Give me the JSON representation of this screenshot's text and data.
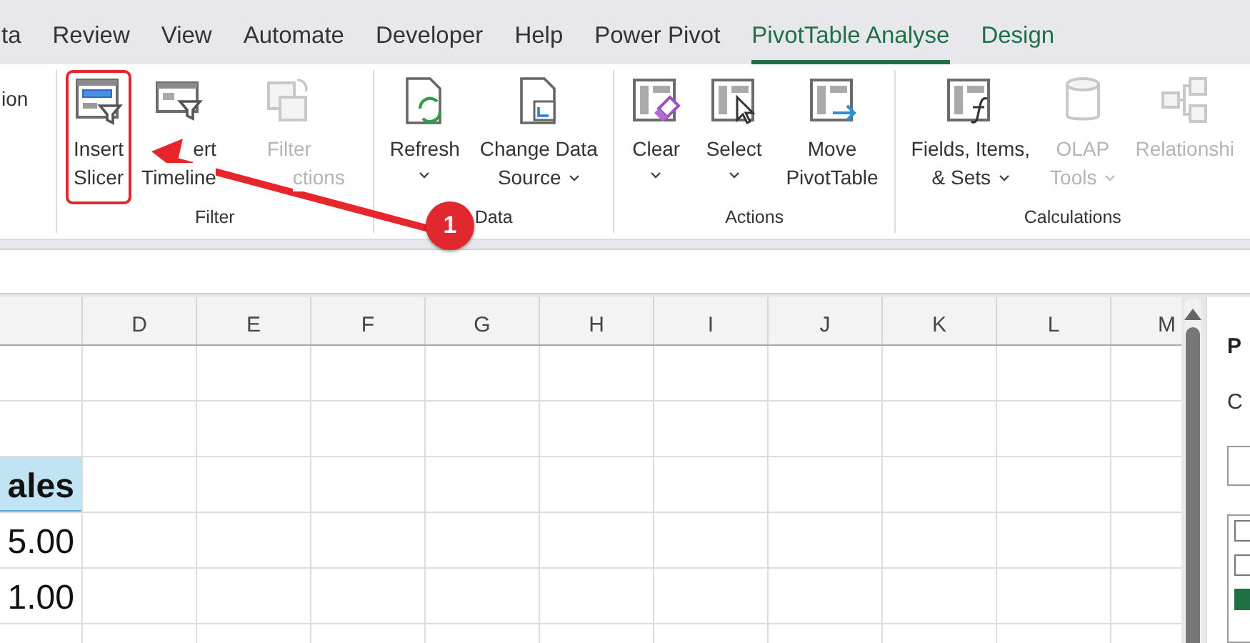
{
  "tabs": [
    {
      "label": "ta",
      "selected": false,
      "contextual": false
    },
    {
      "label": "Review",
      "selected": false,
      "contextual": false
    },
    {
      "label": "View",
      "selected": false,
      "contextual": false
    },
    {
      "label": "Automate",
      "selected": false,
      "contextual": false
    },
    {
      "label": "Developer",
      "selected": false,
      "contextual": false
    },
    {
      "label": "Help",
      "selected": false,
      "contextual": false
    },
    {
      "label": "Power Pivot",
      "selected": false,
      "contextual": false
    },
    {
      "label": "PivotTable Analyse",
      "selected": true,
      "contextual": true
    },
    {
      "label": "Design",
      "selected": false,
      "contextual": true
    }
  ],
  "ribbon": {
    "partial_label": "ion",
    "groups": [
      {
        "name": "Filter",
        "buttons": [
          {
            "lines": [
              "Insert",
              "Slicer"
            ],
            "dropdown": false,
            "disabled": false,
            "highlighted": true
          },
          {
            "lines": [
              "ert",
              "Timeline"
            ],
            "dropdown": false,
            "disabled": false,
            "highlighted": false
          },
          {
            "lines": [
              "Filter",
              "ctions"
            ],
            "dropdown": false,
            "disabled": true,
            "highlighted": false
          }
        ]
      },
      {
        "name": "Data",
        "buttons": [
          {
            "lines": [
              "Refresh"
            ],
            "dropdown": true,
            "disabled": false,
            "highlighted": false
          },
          {
            "lines": [
              "Change Data",
              "Source"
            ],
            "dropdown": true,
            "disabled": false,
            "highlighted": false
          }
        ]
      },
      {
        "name": "Actions",
        "buttons": [
          {
            "lines": [
              "Clear"
            ],
            "dropdown": true,
            "disabled": false,
            "highlighted": false
          },
          {
            "lines": [
              "Select"
            ],
            "dropdown": true,
            "disabled": false,
            "highlighted": false
          },
          {
            "lines": [
              "Move",
              "PivotTable"
            ],
            "dropdown": false,
            "disabled": false,
            "highlighted": false
          }
        ]
      },
      {
        "name": "Calculations",
        "buttons": [
          {
            "lines": [
              "Fields, Items,",
              "& Sets"
            ],
            "dropdown": true,
            "disabled": false,
            "highlighted": false
          },
          {
            "lines": [
              "OLAP",
              "Tools"
            ],
            "dropdown": true,
            "disabled": true,
            "highlighted": false
          },
          {
            "lines": [
              "Relationshi"
            ],
            "dropdown": false,
            "disabled": true,
            "highlighted": false
          }
        ]
      }
    ]
  },
  "sheet": {
    "columns": [
      "D",
      "E",
      "F",
      "G",
      "H",
      "I",
      "J",
      "K",
      "L",
      "M"
    ],
    "column_c_cells": [
      {
        "text": "ales",
        "kind": "header"
      },
      {
        "text": "5.00",
        "kind": "plain"
      },
      {
        "text": "1.00",
        "kind": "plain"
      }
    ]
  },
  "field_pane": {
    "title": "P",
    "subtitle": "C",
    "fields": [
      {
        "checked": false
      },
      {
        "checked": false
      },
      {
        "checked": true
      }
    ]
  },
  "annotation": {
    "badge": "1"
  }
}
